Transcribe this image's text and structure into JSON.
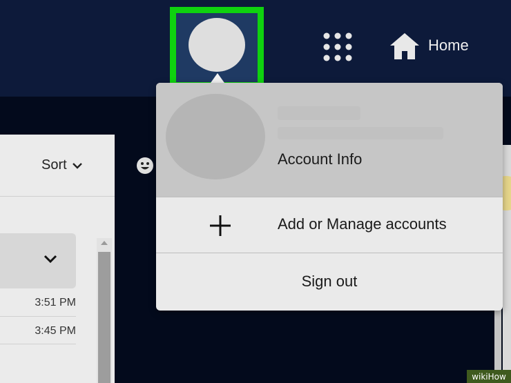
{
  "header": {
    "home_label": "Home",
    "icons": [
      "avatar-icon",
      "apps-grid-icon",
      "home-icon"
    ]
  },
  "mail_list": {
    "sort_label": "Sort",
    "times": [
      "3:51 PM",
      "3:45 PM"
    ]
  },
  "account_menu": {
    "account_info_label": "Account Info",
    "manage_accounts_label": "Add or Manage accounts",
    "sign_out_label": "Sign out"
  },
  "colors": {
    "header_bg": "#0d1a3a",
    "highlight_box": "#0fd20f",
    "menu_bg": "#eaeaea",
    "account_section_bg": "#c6c6c6"
  },
  "watermark": {
    "text": "wikiHow"
  }
}
